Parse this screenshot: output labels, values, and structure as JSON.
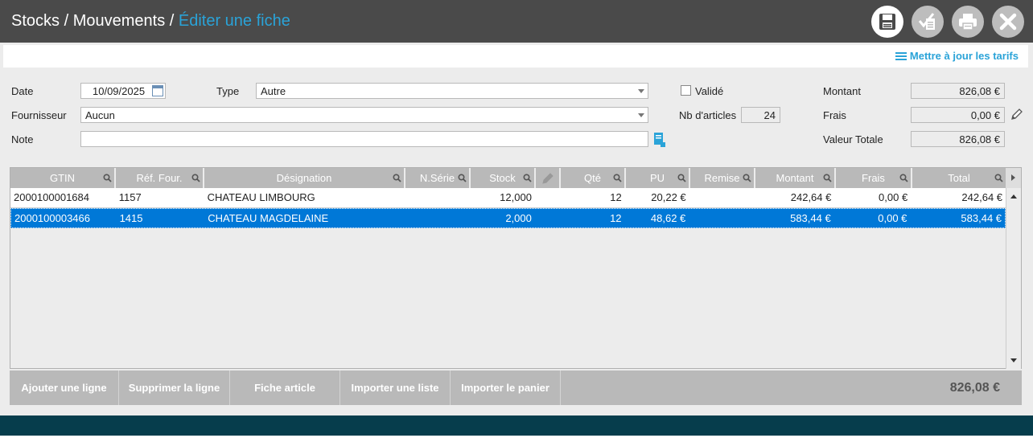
{
  "breadcrumb": {
    "part1": "Stocks",
    "sep1": " / ",
    "part2": "Mouvements",
    "sep2": " / ",
    "current": "Éditer une fiche"
  },
  "toolbar": {
    "save": "save-icon",
    "validate": "validate-icon",
    "print": "print-icon",
    "close": "close-icon"
  },
  "update_prices_link": "Mettre à jour les tarifs",
  "form": {
    "date_label": "Date",
    "date_value": "10/09/2025",
    "type_label": "Type",
    "type_value": "Autre",
    "valide_label": "Validé",
    "montant_label": "Montant",
    "montant_value": "826,08 €",
    "fournisseur_label": "Fournisseur",
    "fournisseur_value": "Aucun",
    "nb_articles_label": "Nb d'articles",
    "nb_articles_value": "24",
    "frais_label": "Frais",
    "frais_value": "0,00 €",
    "note_label": "Note",
    "note_value": "",
    "valeur_totale_label": "Valeur Totale",
    "valeur_totale_value": "826,08 €"
  },
  "grid": {
    "columns": [
      "GTIN",
      "Réf. Four.",
      "Désignation",
      "N.Série",
      "Stock",
      "",
      "Qté",
      "PU",
      "Remise",
      "Montant",
      "Frais",
      "Total"
    ],
    "rows": [
      {
        "gtin": "2000100001684",
        "ref": "1157",
        "designation": "CHATEAU LIMBOURG",
        "serie": "",
        "stock": "12,000",
        "qte": "12",
        "pu": "20,22 €",
        "remise": "",
        "montant": "242,64 €",
        "frais": "0,00 €",
        "total": "242,64 €"
      },
      {
        "gtin": "2000100003466",
        "ref": "1415",
        "designation": "CHATEAU MAGDELAINE",
        "serie": "",
        "stock": "2,000",
        "qte": "12",
        "pu": "48,62 €",
        "remise": "",
        "montant": "583,44 €",
        "frais": "0,00 €",
        "total": "583,44 €"
      }
    ]
  },
  "footer": {
    "add_line": "Ajouter une ligne",
    "delete_line": "Supprimer la ligne",
    "item_sheet": "Fiche article",
    "import_list": "Importer une liste",
    "import_cart": "Importer le panier",
    "total": "826,08 €"
  },
  "colors": {
    "accent": "#2aa3d8",
    "selection": "#0078d7",
    "header_bg": "#4a4a4a",
    "bottom_bar": "#063d4c"
  }
}
